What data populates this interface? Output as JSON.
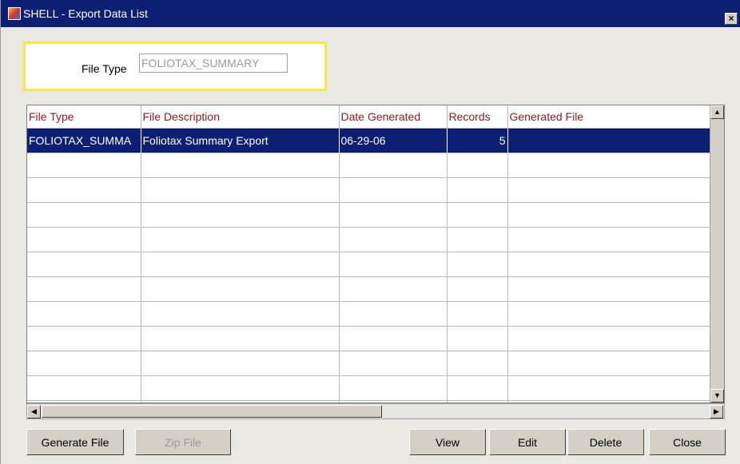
{
  "window": {
    "title": "SHELL - Export Data List",
    "close_glyph": "×"
  },
  "filter": {
    "label": "File Type",
    "value": "FOLIOTAX_SUMMARY"
  },
  "table": {
    "columns": [
      "File Type",
      "File Description",
      "Date Generated",
      "Records",
      "Generated File"
    ],
    "rows": [
      {
        "file_type": "FOLIOTAX_SUMMA",
        "description": "Foliotax Summary Export",
        "date": "06-29-06",
        "records": "5",
        "generated_file": ""
      }
    ]
  },
  "buttons": {
    "generate": "Generate File",
    "zip": "Zip File",
    "view": "View",
    "edit": "Edit",
    "delete": "Delete",
    "close": "Close"
  },
  "colors": {
    "title_bar": "#0c1f72",
    "header_text": "#8f1a1a",
    "highlight_box": "#f1ea47"
  }
}
